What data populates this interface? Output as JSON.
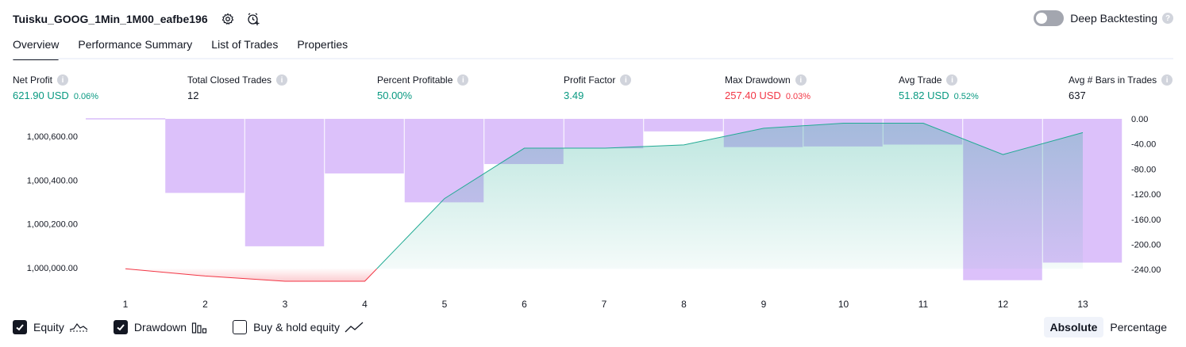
{
  "header": {
    "strategy_name": "Tuisku_GOOG_1Min_1M00_eafbe196",
    "icons": [
      "settings-icon",
      "add-alert-icon"
    ]
  },
  "deep_backtesting": {
    "label": "Deep Backtesting",
    "enabled": false,
    "help_icon": "question-icon"
  },
  "tabs": [
    {
      "label": "Overview",
      "active": true
    },
    {
      "label": "Performance Summary",
      "active": false
    },
    {
      "label": "List of Trades",
      "active": false
    },
    {
      "label": "Properties",
      "active": false
    }
  ],
  "metrics": {
    "net_profit": {
      "label": "Net Profit",
      "value": "621.90 USD",
      "pct": "0.06%",
      "color": "#089981"
    },
    "total_closed_trades": {
      "label": "Total Closed Trades",
      "value": "12"
    },
    "percent_profitable": {
      "label": "Percent Profitable",
      "value": "50.00%",
      "color": "#089981"
    },
    "profit_factor": {
      "label": "Profit Factor",
      "value": "3.49",
      "color": "#089981"
    },
    "max_drawdown": {
      "label": "Max Drawdown",
      "value": "257.40 USD",
      "pct": "0.03%",
      "color": "#f23645"
    },
    "avg_trade": {
      "label": "Avg Trade",
      "value": "51.82 USD",
      "pct": "0.52%",
      "color": "#089981"
    },
    "avg_bars": {
      "label": "Avg # Bars in Trades",
      "value": "637"
    }
  },
  "chart_data": {
    "type": "area",
    "x": [
      1,
      2,
      3,
      4,
      5,
      6,
      7,
      8,
      9,
      10,
      11,
      12,
      13
    ],
    "series": [
      {
        "name": "Equity",
        "type": "line",
        "axis": "left",
        "values": [
          999995,
          999962,
          999938,
          999938,
          1000316,
          1000546,
          1000546,
          1000561,
          1000637,
          1000660,
          1000660,
          1000517,
          1000617
        ]
      },
      {
        "name": "Drawdown",
        "type": "bar",
        "axis": "right",
        "values": [
          0,
          -118,
          -203,
          -87,
          -133,
          -72,
          -47,
          -20,
          -45,
          -44,
          -41,
          -257,
          -229
        ]
      }
    ],
    "left_axis": {
      "ticks": [
        "1,000,000.00",
        "1,000,200.00",
        "1,000,400.00",
        "1,000,600.00"
      ],
      "range": [
        999920,
        1000680
      ]
    },
    "right_axis": {
      "ticks": [
        "0.00",
        "-40.00",
        "-80.00",
        "-120.00",
        "-160.00",
        "-200.00",
        "-240.00"
      ],
      "range": [
        -265,
        0
      ]
    },
    "colors": {
      "equity_line": "#22ab94",
      "equity_fill": "#22ab94",
      "loss_line": "#f23645",
      "drawdown_bar": "#c69bf7"
    }
  },
  "legend": [
    {
      "label": "Equity",
      "checked": true,
      "icon": "equity-line-icon"
    },
    {
      "label": "Drawdown",
      "checked": true,
      "icon": "drawdown-bars-icon"
    },
    {
      "label": "Buy & hold equity",
      "checked": false,
      "icon": "buy-hold-line-icon"
    }
  ],
  "mode": {
    "absolute": "Absolute",
    "percentage": "Percentage",
    "active": "absolute"
  }
}
